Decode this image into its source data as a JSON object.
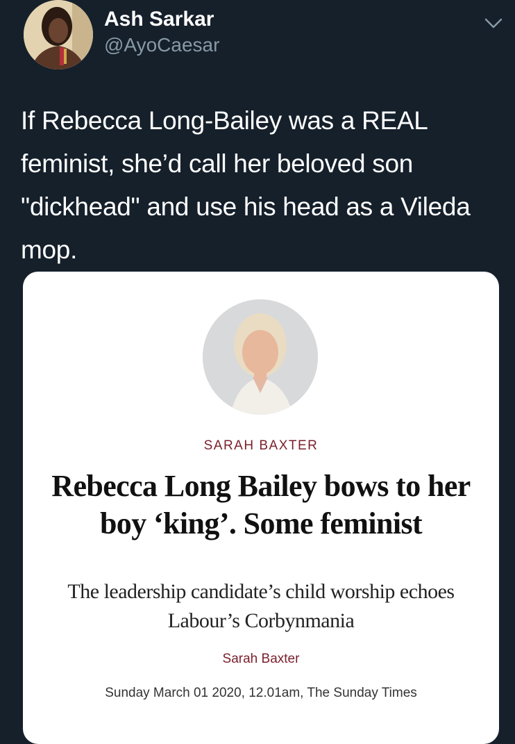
{
  "tweet": {
    "author_name": "Ash Sarkar",
    "author_handle": "@AyoCaesar",
    "text": "If Rebecca Long-Bailey was a REAL feminist, she’d call her beloved son \"dickhead\" and use his head as a Vileda mop.",
    "menu_icon": "chevron-down-icon"
  },
  "article_card": {
    "byline_top": "SARAH BAXTER",
    "headline": "Rebecca Long Bailey bows to her boy ‘king’. Some feminist",
    "subheadline": "The leadership candidate’s child worship echoes Labour’s Corbynmania",
    "author_link": "Sarah Baxter",
    "dateline": "Sunday March 01 2020, 12.01am, The Sunday Times"
  },
  "colors": {
    "background": "#15202b",
    "handle_gray": "#8899a6",
    "accent_maroon": "#7a1f2b"
  }
}
